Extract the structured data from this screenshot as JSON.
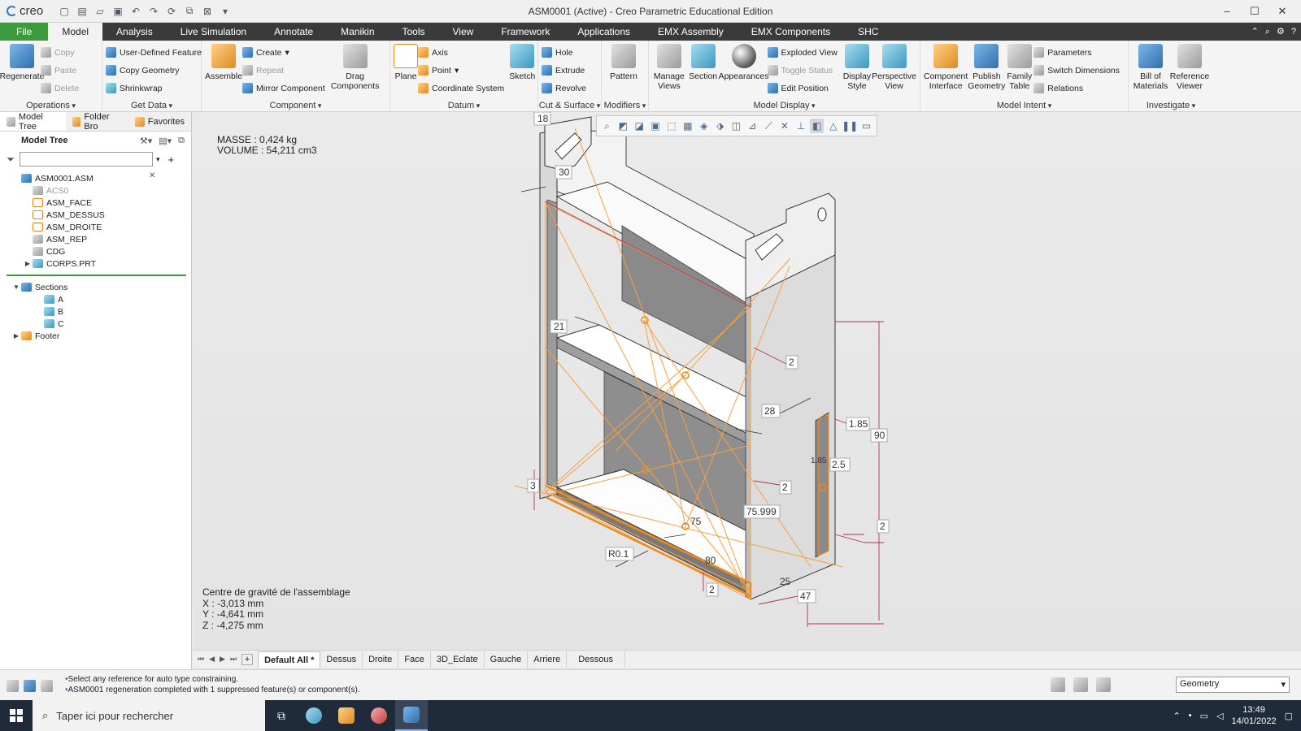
{
  "app": {
    "logo": "creo",
    "title": "ASM0001 (Active) - Creo Parametric Educational Edition",
    "window_controls": [
      "minimize-icon",
      "maximize-icon",
      "close-icon"
    ]
  },
  "tabs": [
    "File",
    "Model",
    "Analysis",
    "Live Simulation",
    "Annotate",
    "Manikin",
    "Tools",
    "View",
    "Framework",
    "Applications",
    "EMX Assembly",
    "EMX Components",
    "SHC"
  ],
  "active_tab": "Model",
  "ribbon": {
    "operations": {
      "label": "Operations",
      "regenerate": "Regenerate",
      "copy": "Copy",
      "paste": "Paste",
      "delete": "Delete"
    },
    "get_data": {
      "label": "Get Data",
      "user_defined_feature": "User-Defined Feature",
      "copy_geometry": "Copy Geometry",
      "shrinkwrap": "Shrinkwrap"
    },
    "component": {
      "label": "Component",
      "assemble": "Assemble",
      "create": "Create",
      "repeat": "Repeat",
      "mirror_component": "Mirror Component",
      "drag_components": "Drag Components"
    },
    "datum": {
      "label": "Datum",
      "plane": "Plane",
      "axis": "Axis",
      "point": "Point",
      "coordinate_system": "Coordinate System",
      "sketch": "Sketch"
    },
    "cut_surface": {
      "label": "Cut & Surface",
      "hole": "Hole",
      "extrude": "Extrude",
      "revolve": "Revolve"
    },
    "modifiers": {
      "label": "Modifiers",
      "pattern": "Pattern"
    },
    "model_display": {
      "label": "Model Display",
      "manage_views": "Manage Views",
      "section": "Section",
      "appearances": "Appearances",
      "exploded_view": "Exploded View",
      "toggle_status": "Toggle Status",
      "edit_position": "Edit Position",
      "display_style": "Display Style",
      "perspective_view": "Perspective View"
    },
    "model_intent": {
      "label": "Model Intent",
      "component_interface": "Component Interface",
      "publish_geometry": "Publish Geometry",
      "family_table": "Family Table",
      "parameters": "Parameters",
      "switch_dimensions": "Switch Dimensions",
      "relations": "Relations"
    },
    "investigate": {
      "label": "Investigate",
      "bill_of_materials": "Bill of Materials",
      "reference_viewer": "Reference Viewer"
    }
  },
  "left_panel": {
    "tabs": [
      "Model Tree",
      "Folder Bro",
      "Favorites"
    ],
    "header": "Model Tree",
    "filter_placeholder": "",
    "tree": [
      {
        "label": "ASM0001.ASM",
        "icon": "assembly-icon",
        "level": 0,
        "dim": false,
        "exp": ""
      },
      {
        "label": "ACS0",
        "icon": "csys-icon",
        "level": 1,
        "dim": true,
        "exp": ""
      },
      {
        "label": "ASM_FACE",
        "icon": "datum-plane-icon",
        "level": 1,
        "dim": false,
        "exp": ""
      },
      {
        "label": "ASM_DESSUS",
        "icon": "datum-plane-icon",
        "level": 1,
        "dim": false,
        "exp": ""
      },
      {
        "label": "ASM_DROITE",
        "icon": "datum-plane-icon",
        "level": 1,
        "dim": false,
        "exp": ""
      },
      {
        "label": "ASM_REP",
        "icon": "csys-icon",
        "level": 1,
        "dim": false,
        "exp": ""
      },
      {
        "label": "CDG",
        "icon": "datum-point-icon",
        "level": 1,
        "dim": false,
        "exp": ""
      },
      {
        "label": "CORPS.PRT",
        "icon": "part-icon",
        "level": 1,
        "dim": false,
        "exp": "▶"
      }
    ],
    "sections": [
      {
        "label": "Sections",
        "icon": "sections-icon",
        "level": 0,
        "exp": "▼"
      },
      {
        "label": "A",
        "icon": "section-icon",
        "level": 2,
        "exp": ""
      },
      {
        "label": "B",
        "icon": "section-icon",
        "level": 2,
        "exp": ""
      },
      {
        "label": "C",
        "icon": "section-icon",
        "level": 2,
        "exp": ""
      },
      {
        "label": "Footer",
        "icon": "footer-icon",
        "level": 0,
        "exp": "▶"
      }
    ]
  },
  "viewport": {
    "mass": "MASSE : 0,424 kg",
    "volume": "VOLUME : 54,211 cm3",
    "cg_title": "Centre de gravité de l'assemblage",
    "cg_x": "X : -3,013 mm",
    "cg_y": "Y : -4,641 mm",
    "cg_z": "Z : -4,275 mm",
    "dimensions": [
      "18",
      "30",
      "21",
      "2",
      "28",
      "1.85",
      "90",
      "2.5",
      "3",
      "2",
      "75.999",
      "75",
      "R0.1",
      "80",
      "2",
      "25",
      "47",
      "2",
      "1.85"
    ]
  },
  "view_tabs": [
    "Default All *",
    "Dessus",
    "Droite",
    "Face",
    "3D_Eclate",
    "Gauche",
    "Arriere",
    "Dessous"
  ],
  "active_view_tab": "Default All *",
  "status": {
    "messages": [
      "Select any reference for auto type constraining.",
      "ASM0001 regeneration completed with 1 suppressed feature(s) or component(s)."
    ],
    "filter_value": "Geometry"
  },
  "taskbar": {
    "search_placeholder": "Taper ici pour rechercher",
    "time": "13:49",
    "date": "14/01/2022"
  }
}
